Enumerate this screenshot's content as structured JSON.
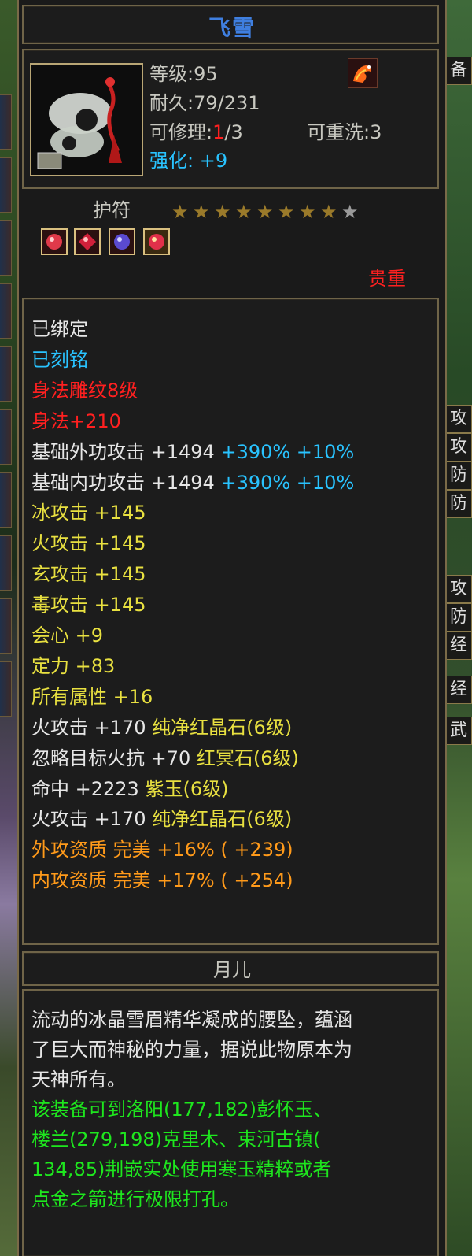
{
  "item": {
    "name": "飞雪",
    "level_label": "等级",
    "level_value": ":95",
    "durability_label": "耐久",
    "durability_value": ":79/231",
    "repair_label": "可修理",
    "repair_used": "1",
    "repair_total": "/3",
    "rewash_label": "可重洗",
    "rewash_value": ":3",
    "enhance_label": "强化",
    "enhance_value": "+9",
    "type": "护符",
    "stars_filled": 8,
    "stars_total": 9,
    "rarity": "贵重",
    "maker": "月儿"
  },
  "attributes": [
    {
      "text": "已绑定",
      "color": "#e6e6e6"
    },
    {
      "text": "已刻铭",
      "color": "#29c3ff"
    },
    {
      "text": "身法雕纹8级",
      "color": "#ff2020"
    },
    {
      "text": "身法+210",
      "color": "#ff2020"
    },
    {
      "parts": [
        {
          "text": "基础外功攻击 +1494 ",
          "color": "#e6e6e6"
        },
        {
          "text": "+390% +10%",
          "color": "#29c3ff"
        }
      ]
    },
    {
      "parts": [
        {
          "text": "基础内功攻击 +1494 ",
          "color": "#e6e6e6"
        },
        {
          "text": "+390% +10%",
          "color": "#29c3ff"
        }
      ]
    },
    {
      "text": "冰攻击 +145",
      "color": "#e8e040"
    },
    {
      "text": "火攻击 +145",
      "color": "#e8e040"
    },
    {
      "text": "玄攻击 +145",
      "color": "#e8e040"
    },
    {
      "text": "毒攻击 +145",
      "color": "#e8e040"
    },
    {
      "text": "会心 +9",
      "color": "#e8e040"
    },
    {
      "text": "定力 +83",
      "color": "#e8e040"
    },
    {
      "text": "所有属性 +16",
      "color": "#e8e040"
    },
    {
      "parts": [
        {
          "text": "火攻击 +170 ",
          "color": "#e6e6e6"
        },
        {
          "text": "纯净红晶石(6级)",
          "color": "#e8e040"
        }
      ]
    },
    {
      "parts": [
        {
          "text": "忽略目标火抗 +70 ",
          "color": "#e6e6e6"
        },
        {
          "text": "红冥石(6级)",
          "color": "#e8e040"
        }
      ]
    },
    {
      "parts": [
        {
          "text": "命中 +2223 ",
          "color": "#e6e6e6"
        },
        {
          "text": "紫玉(6级)",
          "color": "#e8e040"
        }
      ]
    },
    {
      "parts": [
        {
          "text": "火攻击 +170 ",
          "color": "#e6e6e6"
        },
        {
          "text": "纯净红晶石(6级)",
          "color": "#e8e040"
        }
      ]
    },
    {
      "text": "外攻资质  完美 +16% ( +239)",
      "color": "#ff9a1a"
    },
    {
      "text": "内攻资质  完美 +17% ( +254)",
      "color": "#ff9a1a"
    }
  ],
  "description": {
    "line1": "流动的冰晶雪眉精华凝成的腰坠，蕴涵",
    "line2": "了巨大而神秘的力量，据说此物原本为",
    "line3": "天神所有。",
    "green1": "该装备可到洛阳(177,182)彭怀玉、",
    "green2": "楼兰(279,198)克里木、束河古镇(",
    "green3": "134,85)荆嵌实处使用寒玉精粹或者",
    "green4": "点金之箭进行极限打孔。"
  },
  "side_tabs": [
    "备",
    "攻",
    "攻",
    "防",
    "防",
    "攻",
    "防",
    "经",
    "经",
    "武"
  ],
  "colors": {
    "title": "#3f7fe0",
    "frame": "#6f6448",
    "bg": "#1a1a1a"
  }
}
